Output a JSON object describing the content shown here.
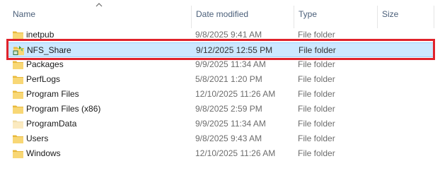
{
  "columns": {
    "name": "Name",
    "date": "Date modified",
    "type": "Type",
    "size": "Size"
  },
  "sort": {
    "column": "Name",
    "direction": "ascending"
  },
  "files": [
    {
      "name": "inetpub",
      "date": "9/8/2025 9:41 AM",
      "type": "File folder",
      "icon": "folder-icon",
      "selected": false
    },
    {
      "name": "NFS_Share",
      "date": "9/12/2025 12:55 PM",
      "type": "File folder",
      "icon": "shared-folder-icon",
      "selected": true
    },
    {
      "name": "Packages",
      "date": "9/9/2025 11:34 AM",
      "type": "File folder",
      "icon": "folder-icon",
      "selected": false
    },
    {
      "name": "PerfLogs",
      "date": "5/8/2021 1:20 PM",
      "type": "File folder",
      "icon": "folder-icon",
      "selected": false
    },
    {
      "name": "Program Files",
      "date": "12/10/2025 11:26 AM",
      "type": "File folder",
      "icon": "folder-icon",
      "selected": false
    },
    {
      "name": "Program Files (x86)",
      "date": "9/8/2025 2:59 PM",
      "type": "File folder",
      "icon": "folder-icon",
      "selected": false
    },
    {
      "name": "ProgramData",
      "date": "9/9/2025 11:34 AM",
      "type": "File folder",
      "icon": "folder-hidden-icon",
      "selected": false
    },
    {
      "name": "Users",
      "date": "9/8/2025 9:43 AM",
      "type": "File folder",
      "icon": "folder-icon",
      "selected": false
    },
    {
      "name": "Windows",
      "date": "12/10/2025 11:26 AM",
      "type": "File folder",
      "icon": "folder-icon",
      "selected": false
    }
  ],
  "colors": {
    "selection": "#cce8ff",
    "annotation": "#e0222b",
    "folder": "#f8d775"
  }
}
